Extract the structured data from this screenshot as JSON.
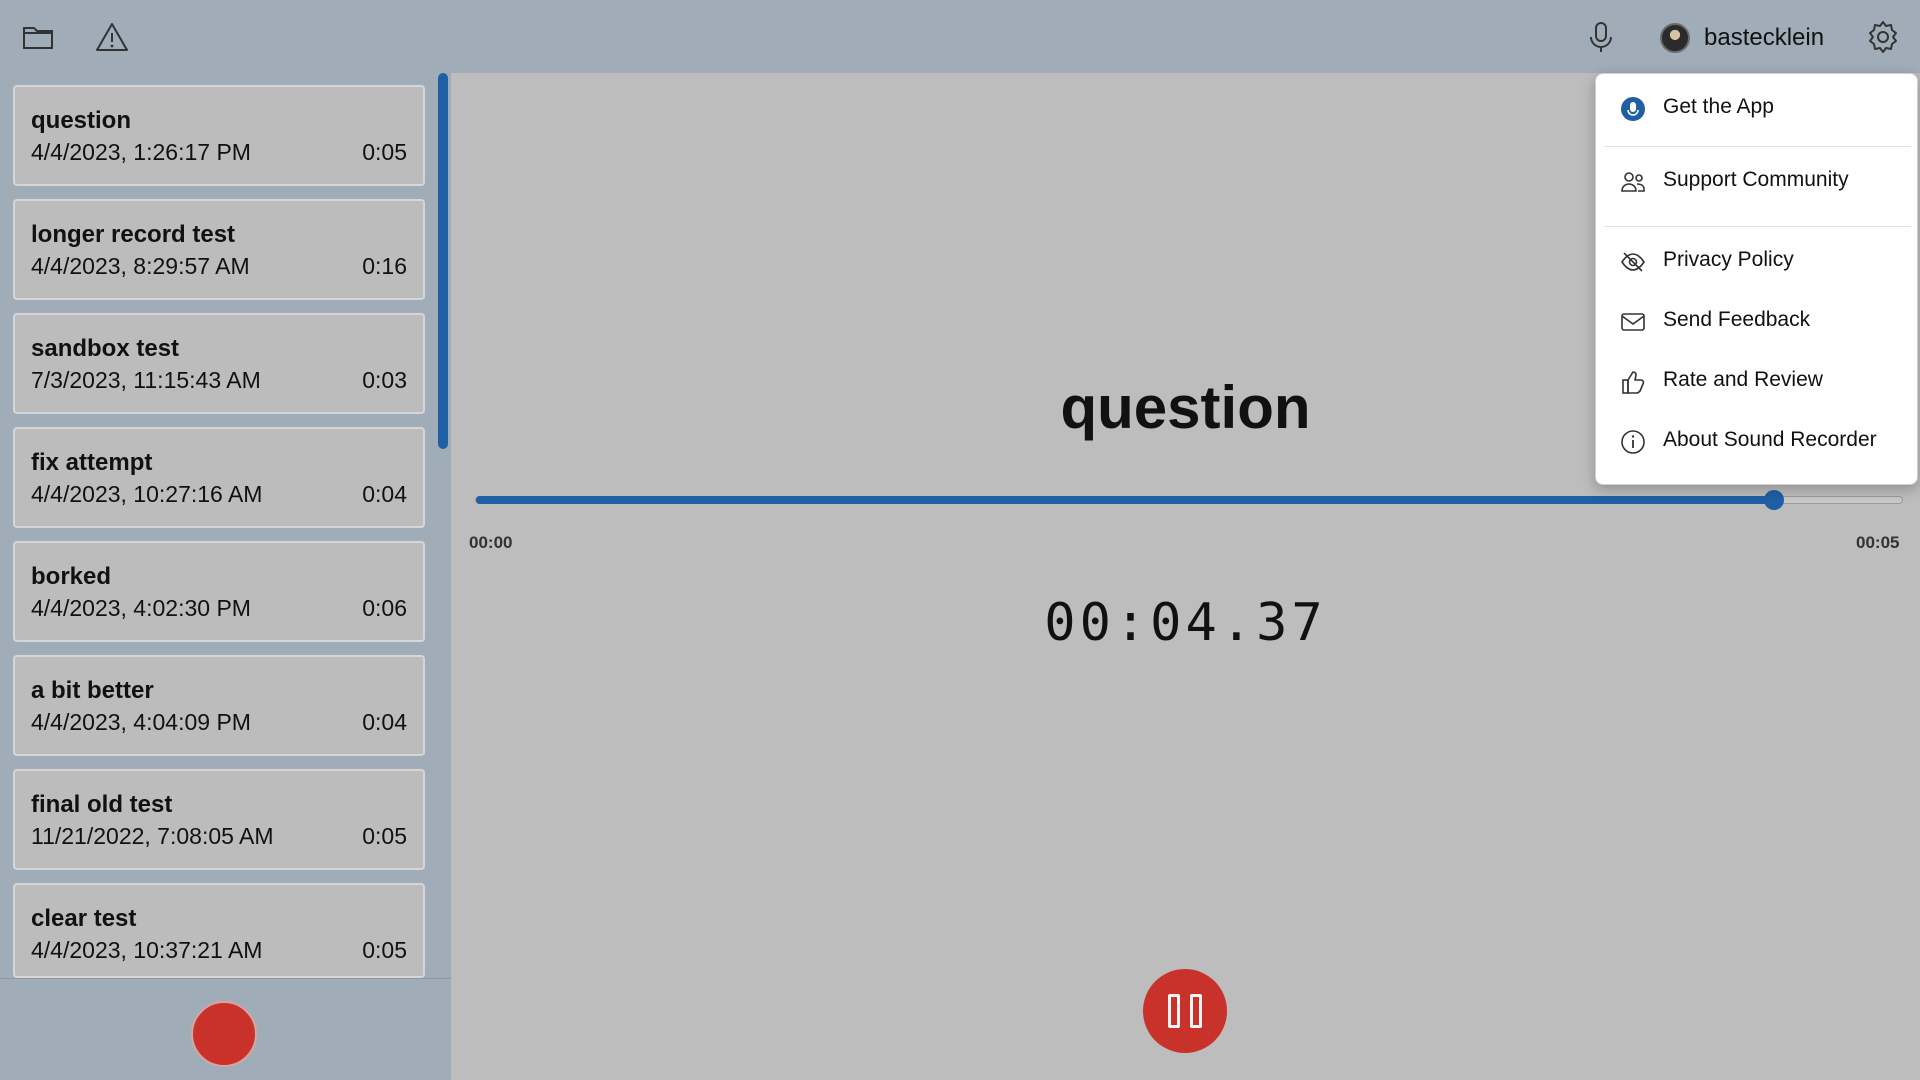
{
  "topbar": {
    "folder_icon": "folder-icon",
    "warning_icon": "warning-icon",
    "mic_icon": "microphone-icon",
    "username": "bastecklein",
    "settings_icon": "gear-icon"
  },
  "recordings": [
    {
      "title": "question",
      "date": "4/4/2023, 1:26:17 PM",
      "duration": "0:05"
    },
    {
      "title": "longer record test",
      "date": "4/4/2023, 8:29:57 AM",
      "duration": "0:16"
    },
    {
      "title": "sandbox test",
      "date": "7/3/2023, 11:15:43 AM",
      "duration": "0:03"
    },
    {
      "title": "fix attempt",
      "date": "4/4/2023, 10:27:16 AM",
      "duration": "0:04"
    },
    {
      "title": "borked",
      "date": "4/4/2023, 4:02:30 PM",
      "duration": "0:06"
    },
    {
      "title": "a bit better",
      "date": "4/4/2023, 4:04:09 PM",
      "duration": "0:04"
    },
    {
      "title": "final old test",
      "date": "11/21/2022, 7:08:05 AM",
      "duration": "0:05"
    },
    {
      "title": "clear test",
      "date": "4/4/2023, 10:37:21 AM",
      "duration": "0:05"
    }
  ],
  "player": {
    "title": "question",
    "start_time": "00:00",
    "end_time": "00:05",
    "progress_fraction": 0.91,
    "clock": "00:04.37"
  },
  "menu": {
    "items": [
      {
        "label": "Get the App",
        "icon": "microphone-badge-icon"
      },
      {
        "label": "Support Community",
        "icon": "people-icon"
      },
      {
        "label": "Privacy Policy",
        "icon": "eye-off-icon"
      },
      {
        "label": "Send Feedback",
        "icon": "mail-icon"
      },
      {
        "label": "Rate and Review",
        "icon": "thumbs-up-icon"
      },
      {
        "label": "About Sound Recorder",
        "icon": "info-icon"
      }
    ]
  },
  "colors": {
    "accent": "#1f5fa4",
    "record": "#c8322a",
    "chrome": "#a0adb8",
    "content": "#bdbdbd"
  }
}
